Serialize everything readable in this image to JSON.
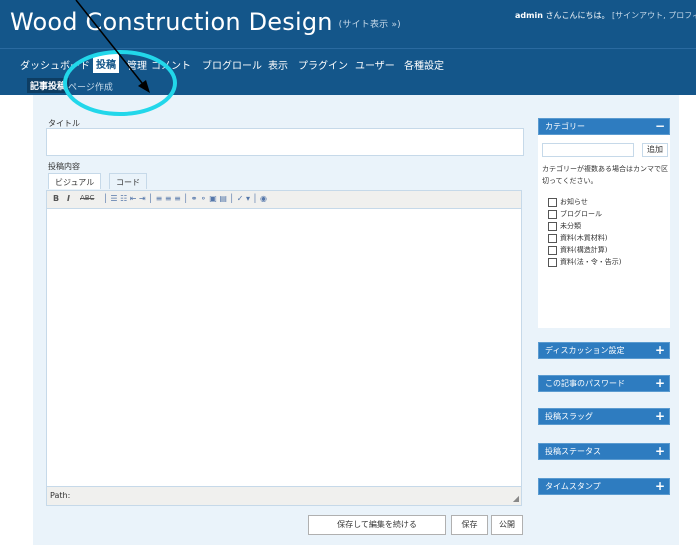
{
  "header": {
    "site_title": "Wood Construction Design",
    "view_site": "(サイト表示 »)",
    "user_name": "admin",
    "greeting": "さんこんにちは。",
    "user_links": "[サインアウト, プロフィ"
  },
  "menu": {
    "items": [
      {
        "label": "ダッシュボード"
      },
      {
        "label": "投稿"
      },
      {
        "label": "管理"
      },
      {
        "label": "コメント"
      },
      {
        "label": "ブログロール"
      },
      {
        "label": "表示"
      },
      {
        "label": "プラグイン"
      },
      {
        "label": "ユーザー"
      },
      {
        "label": "各種設定"
      }
    ],
    "active": "投稿"
  },
  "submenu": {
    "items": [
      {
        "label": "記事投稿"
      },
      {
        "label": "ページ作成"
      }
    ]
  },
  "form": {
    "title_label": "タイトル",
    "title_value": "",
    "content_label": "投稿内容",
    "tab_visual": "ビジュアル",
    "tab_code": "コード",
    "path_label": "Path:",
    "toolbar": {
      "bold": "B",
      "italic": "I",
      "strike": "ABC",
      "rest": "│ ☰ ☷ ⇤ ⇥ │ ≡ ≡ ≡ │ ⚭ ⚬ ▣ ▤ │ ✓ ▾ │ ◉"
    }
  },
  "buttons": {
    "save_continue": "保存して編集を続ける",
    "save": "保存",
    "publish": "公開"
  },
  "sidebar": {
    "category": {
      "title": "カテゴリー",
      "toggle": "−",
      "add_button": "追加",
      "hint": "カテゴリーが複数ある場合はカンマで区切ってください。",
      "items": [
        {
          "label": "お知らせ",
          "checked": false
        },
        {
          "label": "ブログロール",
          "checked": false
        },
        {
          "label": "未分類",
          "checked": false
        },
        {
          "label": "資料(木質材料)",
          "checked": false
        },
        {
          "label": "資料(構造計算)",
          "checked": false
        },
        {
          "label": "資料(法・令・告示)",
          "checked": false
        }
      ]
    },
    "panels": [
      {
        "title": "ディスカッション設定",
        "toggle": "+"
      },
      {
        "title": "この記事のパスワード",
        "toggle": "+"
      },
      {
        "title": "投稿スラッグ",
        "toggle": "+"
      },
      {
        "title": "投稿ステータス",
        "toggle": "+"
      },
      {
        "title": "タイムスタンプ",
        "toggle": "+"
      }
    ]
  },
  "colors": {
    "header_bg": "#14568a",
    "panel_head": "#2e7cc0",
    "annotation_circle": "#22d7ea",
    "content_bg": "#eaf3fa"
  }
}
